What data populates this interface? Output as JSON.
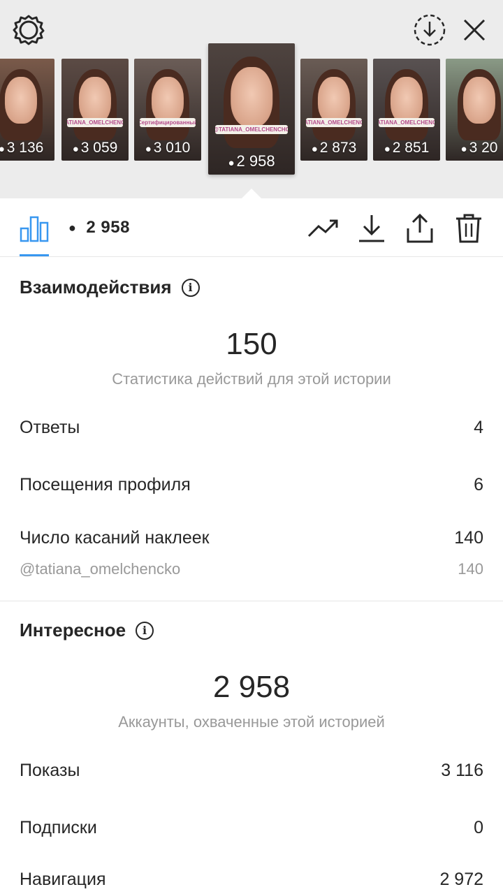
{
  "header": {
    "icons": {
      "settings": "gear-icon",
      "download_circle": "download-circle-icon",
      "close": "close-icon"
    }
  },
  "thumbnails": [
    {
      "views": "3 136",
      "sticker": "",
      "bg": "#7a5a4a",
      "active": false
    },
    {
      "views": "3 059",
      "sticker": "@TATIANA_OMELCHENCHO",
      "bg": "#5c4b45",
      "active": false
    },
    {
      "views": "3 010",
      "sticker": "Сертифицированный",
      "bg": "#6b5d57",
      "active": false
    },
    {
      "views": "2 958",
      "sticker": "@TATIANA_OMELCHENCHO",
      "bg": "#4f4440",
      "active": true
    },
    {
      "views": "2 873",
      "sticker": "@TATIANA_OMELCHENCHO",
      "bg": "#6a5c55",
      "active": false
    },
    {
      "views": "2 851",
      "sticker": "@TATIANA_OMELCHENCHO",
      "bg": "#595252",
      "active": false
    },
    {
      "views": "3 20",
      "sticker": "",
      "bg": "#8a9a86",
      "active": false
    }
  ],
  "toolbar": {
    "view_count": "2 958",
    "icons": {
      "insights": "bar-chart-icon",
      "eye": "eye-icon",
      "trend": "trend-icon",
      "download": "download-icon",
      "share": "share-icon",
      "delete": "trash-icon"
    }
  },
  "interactions": {
    "title": "Взаимодействия",
    "total": "150",
    "caption": "Статистика действий для этой истории",
    "rows": [
      {
        "label": "Ответы",
        "value": "4"
      },
      {
        "label": "Посещения профиля",
        "value": "6"
      },
      {
        "label": "Число касаний наклеек",
        "value": "140"
      }
    ],
    "sticker_row": {
      "label": "@tatiana_omelchencko",
      "value": "140"
    }
  },
  "discovery": {
    "title": "Интересное",
    "total": "2 958",
    "caption": "Аккаунты, охваченные этой историей",
    "rows": [
      {
        "label": "Показы",
        "value": "3 116"
      },
      {
        "label": "Подписки",
        "value": "0"
      },
      {
        "label": "Навигация",
        "value": "2 972"
      }
    ]
  },
  "colors": {
    "accent": "#3897f0",
    "text": "#262626",
    "muted": "#999999",
    "strip_bg": "#ececec"
  }
}
